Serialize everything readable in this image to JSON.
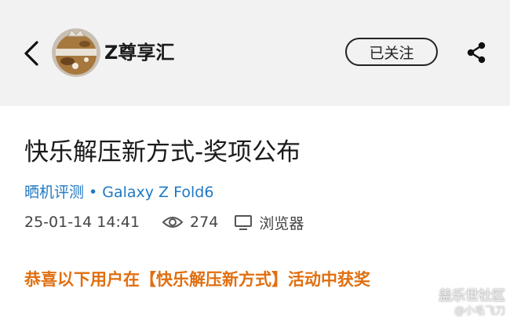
{
  "header": {
    "channel_name": "Z尊享汇",
    "follow_label": "已关注"
  },
  "article": {
    "title": "快乐解压新方式-奖项公布",
    "category": "晒机评测",
    "device_tag": "Galaxy Z Fold6",
    "datetime": "25-01-14 14:41",
    "views": "274",
    "source": "浏览器",
    "announcement": "恭喜以下用户在【快乐解压新方式】活动中获奖"
  },
  "watermark": {
    "line1": "盖乐世社区",
    "line2": "@小毛飞刀"
  },
  "colors": {
    "header_bg": "#f2f2f2",
    "link_blue": "#1f78c3",
    "announce_orange": "#e06f10"
  },
  "icons": [
    "back-arrow-icon",
    "share-icon",
    "eye-icon",
    "monitor-icon"
  ]
}
